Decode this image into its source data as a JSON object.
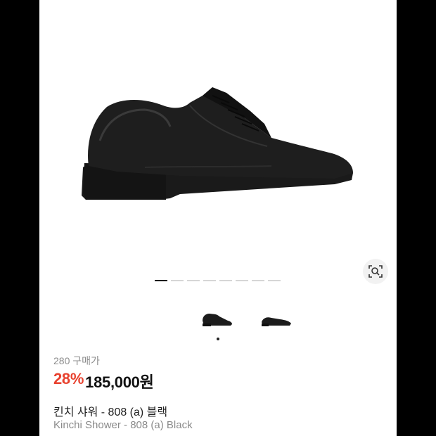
{
  "product": {
    "buyers": "280 구매가",
    "discount": "28%",
    "price": "185,000원",
    "name_ko": "킨치 샤워 - 808 (a) 블랙",
    "name_en": "Kinchi Shower - 808 (a) Black"
  },
  "gallery": {
    "current_index": 1,
    "total_images": 8,
    "thumbnail_count": 2
  },
  "icons": {
    "lens": "image-search-icon",
    "main_image": "black-derby-shoe"
  },
  "colors": {
    "discount": "#e8412e",
    "price": "#111111",
    "secondary_text": "#8a8a8a",
    "frame": "#000000"
  }
}
